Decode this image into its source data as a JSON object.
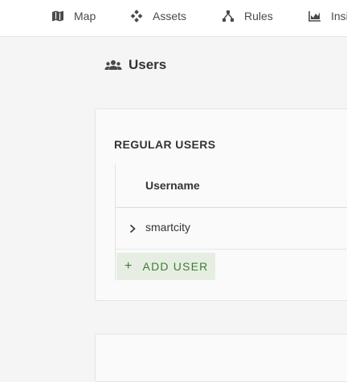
{
  "nav": {
    "items": [
      {
        "label": "Map",
        "icon": "map-icon"
      },
      {
        "label": "Assets",
        "icon": "assets-icon"
      },
      {
        "label": "Rules",
        "icon": "rules-icon"
      },
      {
        "label": "Insi",
        "icon": "insights-icon"
      }
    ]
  },
  "page": {
    "title": "Users",
    "icon": "users-icon"
  },
  "regular_users": {
    "section_title": "REGULAR USERS",
    "columns": [
      "Username"
    ],
    "rows": [
      {
        "username": "smartcity"
      }
    ],
    "add_button_label": "ADD USER",
    "add_button_icon": "plus-icon"
  },
  "colors": {
    "accent_green": "#3f7a2f",
    "add_button_bg": "#e6eee4"
  }
}
